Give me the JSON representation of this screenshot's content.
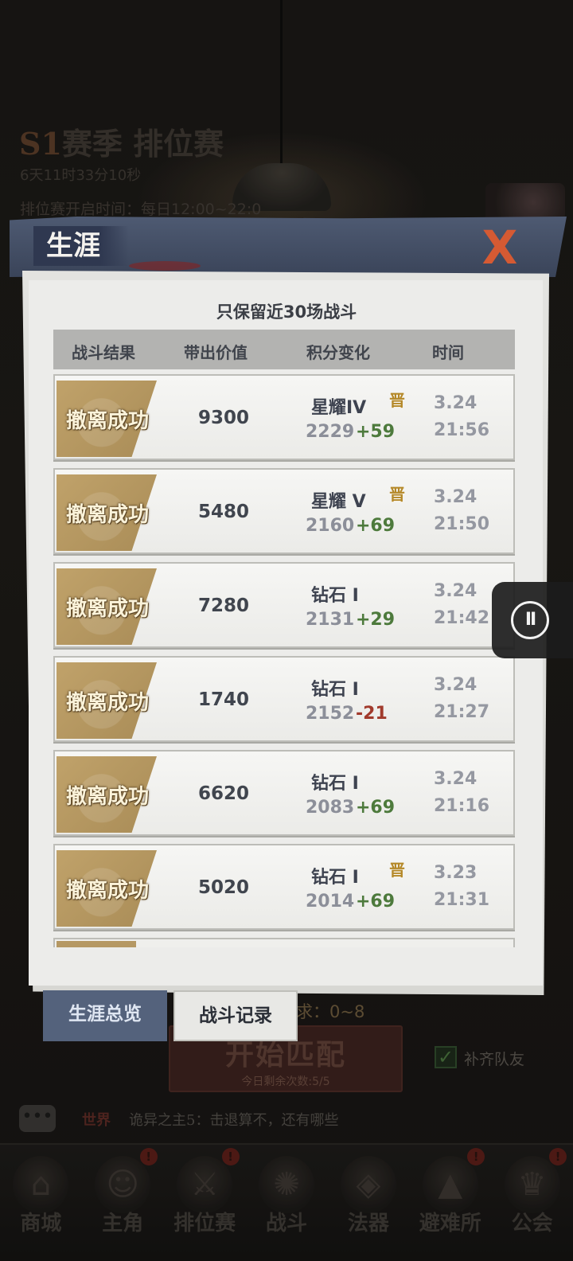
{
  "background": {
    "season_prefix": "S1",
    "season_title": "赛季 排位赛",
    "countdown": "6天11时33分10秒",
    "open_time": "排位赛开启时间：每日12:00~22:0",
    "requirement": "求：0~8",
    "match_button": "开始匹配",
    "match_remaining": "今日剩余次数:5/5",
    "fill_team_label": "补齐队友",
    "chat_channel": "世界",
    "chat_message": "诡异之主5：击退算不，还有哪些"
  },
  "bottom_nav": [
    {
      "label": "商城",
      "icon": "shop-icon",
      "badge": ""
    },
    {
      "label": "主角",
      "icon": "hero-icon",
      "badge": "!"
    },
    {
      "label": "排位赛",
      "icon": "ranked-icon",
      "badge": "!"
    },
    {
      "label": "战斗",
      "icon": "battle-icon",
      "badge": ""
    },
    {
      "label": "法器",
      "icon": "artifact-icon",
      "badge": ""
    },
    {
      "label": "避难所",
      "icon": "shelter-icon",
      "badge": "!"
    },
    {
      "label": "公会",
      "icon": "guild-icon",
      "badge": "!"
    }
  ],
  "modal": {
    "title": "生涯",
    "close_label": "X",
    "subtitle": "只保留近30场战斗",
    "columns": {
      "result": "战斗结果",
      "value": "带出价值",
      "score": "积分变化",
      "time": "时间"
    },
    "records": [
      {
        "result": "撤离成功",
        "value": "9300",
        "rank": "星耀IV",
        "promo": "晋",
        "score": "2229",
        "delta": "+59",
        "delta_sign": "pos",
        "date": "3.24",
        "time": "21:56"
      },
      {
        "result": "撤离成功",
        "value": "5480",
        "rank": "星耀 V",
        "promo": "晋",
        "score": "2160",
        "delta": "+69",
        "delta_sign": "pos",
        "date": "3.24",
        "time": "21:50"
      },
      {
        "result": "撤离成功",
        "value": "7280",
        "rank": "钻石 I",
        "promo": "",
        "score": "2131",
        "delta": "+29",
        "delta_sign": "pos",
        "date": "3.24",
        "time": "21:42"
      },
      {
        "result": "撤离成功",
        "value": "1740",
        "rank": "钻石 I",
        "promo": "",
        "score": "2152",
        "delta": "-21",
        "delta_sign": "neg",
        "date": "3.24",
        "time": "21:27"
      },
      {
        "result": "撤离成功",
        "value": "6620",
        "rank": "钻石 I",
        "promo": "",
        "score": "2083",
        "delta": "+69",
        "delta_sign": "pos",
        "date": "3.24",
        "time": "21:16"
      },
      {
        "result": "撤离成功",
        "value": "5020",
        "rank": "钻石 I",
        "promo": "晋",
        "score": "2014",
        "delta": "+69",
        "delta_sign": "pos",
        "date": "3.23",
        "time": "21:31"
      }
    ],
    "tabs": {
      "overview": "生涯总览",
      "records": "战斗记录"
    }
  },
  "overlay": {
    "pause_symbol": "II"
  }
}
